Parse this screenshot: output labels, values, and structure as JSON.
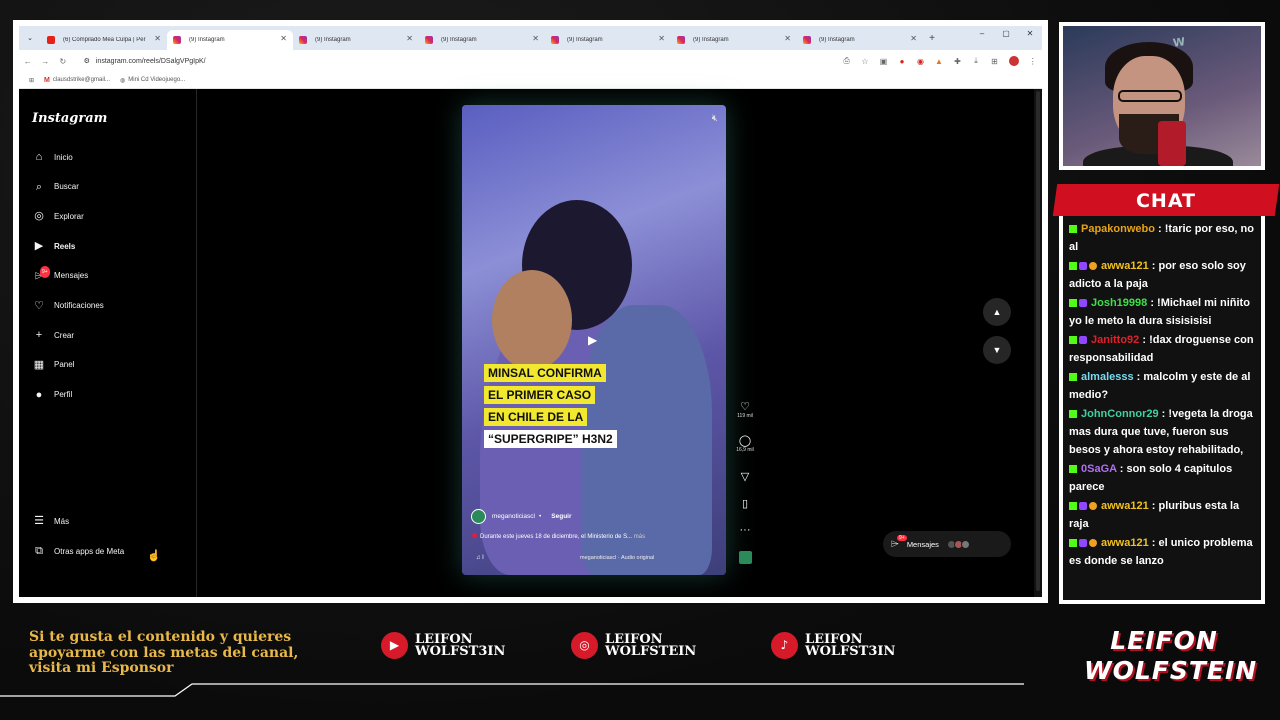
{
  "browser": {
    "tabs": [
      {
        "label": "(6) Compilado Mea Culpa | Per",
        "type": "yt"
      },
      {
        "label": "(9) Instagram",
        "type": "ig",
        "active": true
      },
      {
        "label": "(9) Instagram",
        "type": "ig"
      },
      {
        "label": "(9) Instagram",
        "type": "ig"
      },
      {
        "label": "(9) Instagram",
        "type": "ig"
      },
      {
        "label": "(9) Instagram",
        "type": "ig"
      },
      {
        "label": "(9) Instagram",
        "type": "ig"
      }
    ],
    "url": "instagram.com/reels/DSalgVPgIpK/",
    "bookmarks": [
      "clausdstrike@gmail...",
      "Mini Cd Videojuego..."
    ]
  },
  "instagram": {
    "logo": "Instagram",
    "nav": [
      {
        "label": "Inicio",
        "icon": "home-icon"
      },
      {
        "label": "Buscar",
        "icon": "search-icon"
      },
      {
        "label": "Explorar",
        "icon": "compass-icon"
      },
      {
        "label": "Reels",
        "icon": "reels-icon",
        "bold": true
      },
      {
        "label": "Mensajes",
        "icon": "messenger-icon",
        "badge": "9+"
      },
      {
        "label": "Notificaciones",
        "icon": "heart-icon"
      },
      {
        "label": "Crear",
        "icon": "plus-icon"
      },
      {
        "label": "Panel",
        "icon": "chart-icon"
      },
      {
        "label": "Perfil",
        "icon": "profile-icon"
      }
    ],
    "more": "Más",
    "meta_apps": "Otras apps de Meta",
    "reel": {
      "headline_lines": [
        "MINSAL CONFIRMA",
        "EL PRIMER CASO",
        "EN CHILE DE LA",
        "“SUPERGRIPE” H3N2"
      ],
      "username": "meganoticiascl",
      "follow": "Seguir",
      "caption": "Durante este jueves 18 de diciembre, el Ministerio de S...",
      "caption_more": "más",
      "audio": "♫ I",
      "audio_source": "meganoticiascl · Audio original"
    },
    "actions": {
      "likes": "119 mil",
      "comments": "16,9 mil"
    },
    "messages": {
      "label": "Mensajes",
      "badge": "9+"
    }
  },
  "chat": {
    "title": "CHAT",
    "messages": [
      {
        "user": "Papakonwebo",
        "color": "#e8a317",
        "text": "!taric por eso, no al",
        "badges": [
          "k"
        ]
      },
      {
        "user": "awwa121",
        "color": "#f0c020",
        "text": "por eso solo soy adicto a la paja",
        "badges": [
          "k",
          "p",
          "o"
        ]
      },
      {
        "user": "Josh19998",
        "color": "#3ee04a",
        "text": "!Michael mi niñito yo le meto la dura sisisisisi",
        "badges": [
          "k",
          "p"
        ]
      },
      {
        "user": "Janitto92",
        "color": "#e0202a",
        "text": "!dax droguense con responsabilidad",
        "badges": [
          "k",
          "p"
        ]
      },
      {
        "user": "almalesss",
        "color": "#7ad9f0",
        "text": "malcolm y este de al medio?",
        "badges": [
          "k"
        ]
      },
      {
        "user": "JohnConnor29",
        "color": "#40d0a0",
        "text": "!vegeta la droga mas dura que tuve, fueron sus besos y ahora estoy rehabilitado,",
        "badges": [
          "k"
        ]
      },
      {
        "user": "0SaGA",
        "color": "#b070f0",
        "text": "son solo 4 capitulos parece",
        "badges": [
          "k"
        ]
      },
      {
        "user": "awwa121",
        "color": "#f0c020",
        "text": "pluribus esta la raja",
        "badges": [
          "k",
          "p",
          "o"
        ]
      },
      {
        "user": "awwa121",
        "color": "#f0c020",
        "text": "el unico problema es donde se lanzo",
        "badges": [
          "k",
          "p",
          "o"
        ]
      }
    ]
  },
  "footer": {
    "sponsor_text": "Si te gusta el contenido y quieres apoyarme con las metas del canal, visita mi Esponsor",
    "socials": [
      {
        "platform": "youtube-icon",
        "line1": "LEIFON",
        "line2": "WOLFST3IN"
      },
      {
        "platform": "instagram-icon",
        "line1": "LEIFON",
        "line2": "WOLFSTEIN"
      },
      {
        "platform": "tiktok-icon",
        "line1": "LEIFON",
        "line2": "WOLFST3IN"
      }
    ],
    "brand_line1": "LEIFON",
    "brand_line2": "WOLFSTEIN",
    "accent": "#d61a2a"
  }
}
